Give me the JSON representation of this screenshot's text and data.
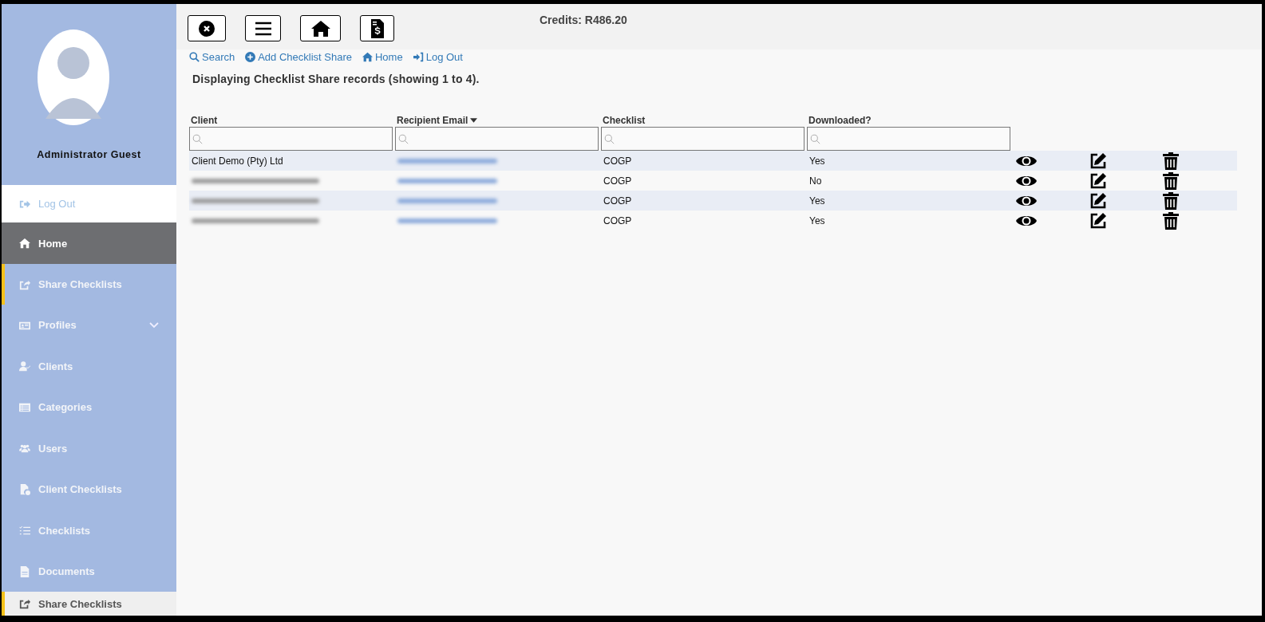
{
  "user": {
    "name": "Administrator Guest"
  },
  "sidebar": {
    "items": [
      {
        "label": "Log Out",
        "kind": "logout",
        "selected": false,
        "marked": false,
        "expandable": false
      },
      {
        "label": "Home",
        "kind": "home",
        "selected": true,
        "marked": false,
        "expandable": false
      },
      {
        "label": "Share Checklists",
        "kind": "share",
        "selected": false,
        "marked": true,
        "expandable": false
      },
      {
        "label": "Profiles",
        "kind": "profile",
        "selected": false,
        "marked": false,
        "expandable": true
      },
      {
        "label": "Clients",
        "kind": "client",
        "selected": false,
        "marked": false,
        "expandable": false
      },
      {
        "label": "Categories",
        "kind": "list",
        "selected": false,
        "marked": false,
        "expandable": false
      },
      {
        "label": "Users",
        "kind": "users",
        "selected": false,
        "marked": false,
        "expandable": false
      },
      {
        "label": "Client Checklists",
        "kind": "filecheck",
        "selected": false,
        "marked": false,
        "expandable": false
      },
      {
        "label": "Checklists",
        "kind": "tasks",
        "selected": false,
        "marked": false,
        "expandable": false
      },
      {
        "label": "Documents",
        "kind": "doc",
        "selected": false,
        "marked": false,
        "expandable": false
      },
      {
        "label": "Share Checklists",
        "kind": "share",
        "selected": false,
        "marked": true,
        "expandable": false,
        "submenu": true
      }
    ]
  },
  "toolbar": {
    "buttons": [
      {
        "kind": "close"
      },
      {
        "kind": "menu"
      },
      {
        "kind": "home"
      },
      {
        "kind": "invoice"
      }
    ],
    "credits": "Credits: R486.20"
  },
  "links": [
    {
      "label": "Search",
      "kind": "search"
    },
    {
      "label": "Add Checklist Share",
      "kind": "add"
    },
    {
      "label": "Home",
      "kind": "home"
    },
    {
      "label": "Log Out",
      "kind": "logout"
    }
  ],
  "heading": "Displaying Checklist Share records (showing 1 to 4).",
  "table": {
    "columns": [
      {
        "label": "Client",
        "sorted": false
      },
      {
        "label": "Recipient Email",
        "sorted": true
      },
      {
        "label": "Checklist",
        "sorted": false
      },
      {
        "label": "Downloaded?",
        "sorted": false
      }
    ],
    "rows": [
      {
        "client": "Client Demo (Pty) Ltd",
        "client_redacted": false,
        "email_redacted": true,
        "checklist": "COGP",
        "downloaded": "Yes"
      },
      {
        "client_redacted": true,
        "email_redacted": true,
        "checklist": "COGP",
        "downloaded": "No"
      },
      {
        "client_redacted": true,
        "email_redacted": true,
        "checklist": "COGP",
        "downloaded": "Yes"
      },
      {
        "client_redacted": true,
        "email_redacted": true,
        "checklist": "COGP",
        "downloaded": "Yes"
      }
    ]
  }
}
